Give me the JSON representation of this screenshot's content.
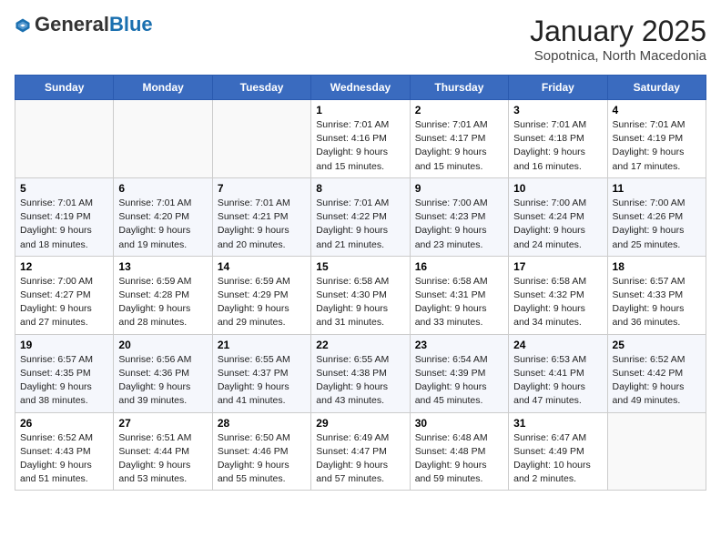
{
  "header": {
    "logo_general": "General",
    "logo_blue": "Blue",
    "title": "January 2025",
    "subtitle": "Sopotnica, North Macedonia"
  },
  "weekdays": [
    "Sunday",
    "Monday",
    "Tuesday",
    "Wednesday",
    "Thursday",
    "Friday",
    "Saturday"
  ],
  "weeks": [
    [
      {
        "day": "",
        "sunrise": "",
        "sunset": "",
        "daylight": ""
      },
      {
        "day": "",
        "sunrise": "",
        "sunset": "",
        "daylight": ""
      },
      {
        "day": "",
        "sunrise": "",
        "sunset": "",
        "daylight": ""
      },
      {
        "day": "1",
        "sunrise": "Sunrise: 7:01 AM",
        "sunset": "Sunset: 4:16 PM",
        "daylight": "Daylight: 9 hours and 15 minutes."
      },
      {
        "day": "2",
        "sunrise": "Sunrise: 7:01 AM",
        "sunset": "Sunset: 4:17 PM",
        "daylight": "Daylight: 9 hours and 15 minutes."
      },
      {
        "day": "3",
        "sunrise": "Sunrise: 7:01 AM",
        "sunset": "Sunset: 4:18 PM",
        "daylight": "Daylight: 9 hours and 16 minutes."
      },
      {
        "day": "4",
        "sunrise": "Sunrise: 7:01 AM",
        "sunset": "Sunset: 4:19 PM",
        "daylight": "Daylight: 9 hours and 17 minutes."
      }
    ],
    [
      {
        "day": "5",
        "sunrise": "Sunrise: 7:01 AM",
        "sunset": "Sunset: 4:19 PM",
        "daylight": "Daylight: 9 hours and 18 minutes."
      },
      {
        "day": "6",
        "sunrise": "Sunrise: 7:01 AM",
        "sunset": "Sunset: 4:20 PM",
        "daylight": "Daylight: 9 hours and 19 minutes."
      },
      {
        "day": "7",
        "sunrise": "Sunrise: 7:01 AM",
        "sunset": "Sunset: 4:21 PM",
        "daylight": "Daylight: 9 hours and 20 minutes."
      },
      {
        "day": "8",
        "sunrise": "Sunrise: 7:01 AM",
        "sunset": "Sunset: 4:22 PM",
        "daylight": "Daylight: 9 hours and 21 minutes."
      },
      {
        "day": "9",
        "sunrise": "Sunrise: 7:00 AM",
        "sunset": "Sunset: 4:23 PM",
        "daylight": "Daylight: 9 hours and 23 minutes."
      },
      {
        "day": "10",
        "sunrise": "Sunrise: 7:00 AM",
        "sunset": "Sunset: 4:24 PM",
        "daylight": "Daylight: 9 hours and 24 minutes."
      },
      {
        "day": "11",
        "sunrise": "Sunrise: 7:00 AM",
        "sunset": "Sunset: 4:26 PM",
        "daylight": "Daylight: 9 hours and 25 minutes."
      }
    ],
    [
      {
        "day": "12",
        "sunrise": "Sunrise: 7:00 AM",
        "sunset": "Sunset: 4:27 PM",
        "daylight": "Daylight: 9 hours and 27 minutes."
      },
      {
        "day": "13",
        "sunrise": "Sunrise: 6:59 AM",
        "sunset": "Sunset: 4:28 PM",
        "daylight": "Daylight: 9 hours and 28 minutes."
      },
      {
        "day": "14",
        "sunrise": "Sunrise: 6:59 AM",
        "sunset": "Sunset: 4:29 PM",
        "daylight": "Daylight: 9 hours and 29 minutes."
      },
      {
        "day": "15",
        "sunrise": "Sunrise: 6:58 AM",
        "sunset": "Sunset: 4:30 PM",
        "daylight": "Daylight: 9 hours and 31 minutes."
      },
      {
        "day": "16",
        "sunrise": "Sunrise: 6:58 AM",
        "sunset": "Sunset: 4:31 PM",
        "daylight": "Daylight: 9 hours and 33 minutes."
      },
      {
        "day": "17",
        "sunrise": "Sunrise: 6:58 AM",
        "sunset": "Sunset: 4:32 PM",
        "daylight": "Daylight: 9 hours and 34 minutes."
      },
      {
        "day": "18",
        "sunrise": "Sunrise: 6:57 AM",
        "sunset": "Sunset: 4:33 PM",
        "daylight": "Daylight: 9 hours and 36 minutes."
      }
    ],
    [
      {
        "day": "19",
        "sunrise": "Sunrise: 6:57 AM",
        "sunset": "Sunset: 4:35 PM",
        "daylight": "Daylight: 9 hours and 38 minutes."
      },
      {
        "day": "20",
        "sunrise": "Sunrise: 6:56 AM",
        "sunset": "Sunset: 4:36 PM",
        "daylight": "Daylight: 9 hours and 39 minutes."
      },
      {
        "day": "21",
        "sunrise": "Sunrise: 6:55 AM",
        "sunset": "Sunset: 4:37 PM",
        "daylight": "Daylight: 9 hours and 41 minutes."
      },
      {
        "day": "22",
        "sunrise": "Sunrise: 6:55 AM",
        "sunset": "Sunset: 4:38 PM",
        "daylight": "Daylight: 9 hours and 43 minutes."
      },
      {
        "day": "23",
        "sunrise": "Sunrise: 6:54 AM",
        "sunset": "Sunset: 4:39 PM",
        "daylight": "Daylight: 9 hours and 45 minutes."
      },
      {
        "day": "24",
        "sunrise": "Sunrise: 6:53 AM",
        "sunset": "Sunset: 4:41 PM",
        "daylight": "Daylight: 9 hours and 47 minutes."
      },
      {
        "day": "25",
        "sunrise": "Sunrise: 6:52 AM",
        "sunset": "Sunset: 4:42 PM",
        "daylight": "Daylight: 9 hours and 49 minutes."
      }
    ],
    [
      {
        "day": "26",
        "sunrise": "Sunrise: 6:52 AM",
        "sunset": "Sunset: 4:43 PM",
        "daylight": "Daylight: 9 hours and 51 minutes."
      },
      {
        "day": "27",
        "sunrise": "Sunrise: 6:51 AM",
        "sunset": "Sunset: 4:44 PM",
        "daylight": "Daylight: 9 hours and 53 minutes."
      },
      {
        "day": "28",
        "sunrise": "Sunrise: 6:50 AM",
        "sunset": "Sunset: 4:46 PM",
        "daylight": "Daylight: 9 hours and 55 minutes."
      },
      {
        "day": "29",
        "sunrise": "Sunrise: 6:49 AM",
        "sunset": "Sunset: 4:47 PM",
        "daylight": "Daylight: 9 hours and 57 minutes."
      },
      {
        "day": "30",
        "sunrise": "Sunrise: 6:48 AM",
        "sunset": "Sunset: 4:48 PM",
        "daylight": "Daylight: 9 hours and 59 minutes."
      },
      {
        "day": "31",
        "sunrise": "Sunrise: 6:47 AM",
        "sunset": "Sunset: 4:49 PM",
        "daylight": "Daylight: 10 hours and 2 minutes."
      },
      {
        "day": "",
        "sunrise": "",
        "sunset": "",
        "daylight": ""
      }
    ]
  ]
}
